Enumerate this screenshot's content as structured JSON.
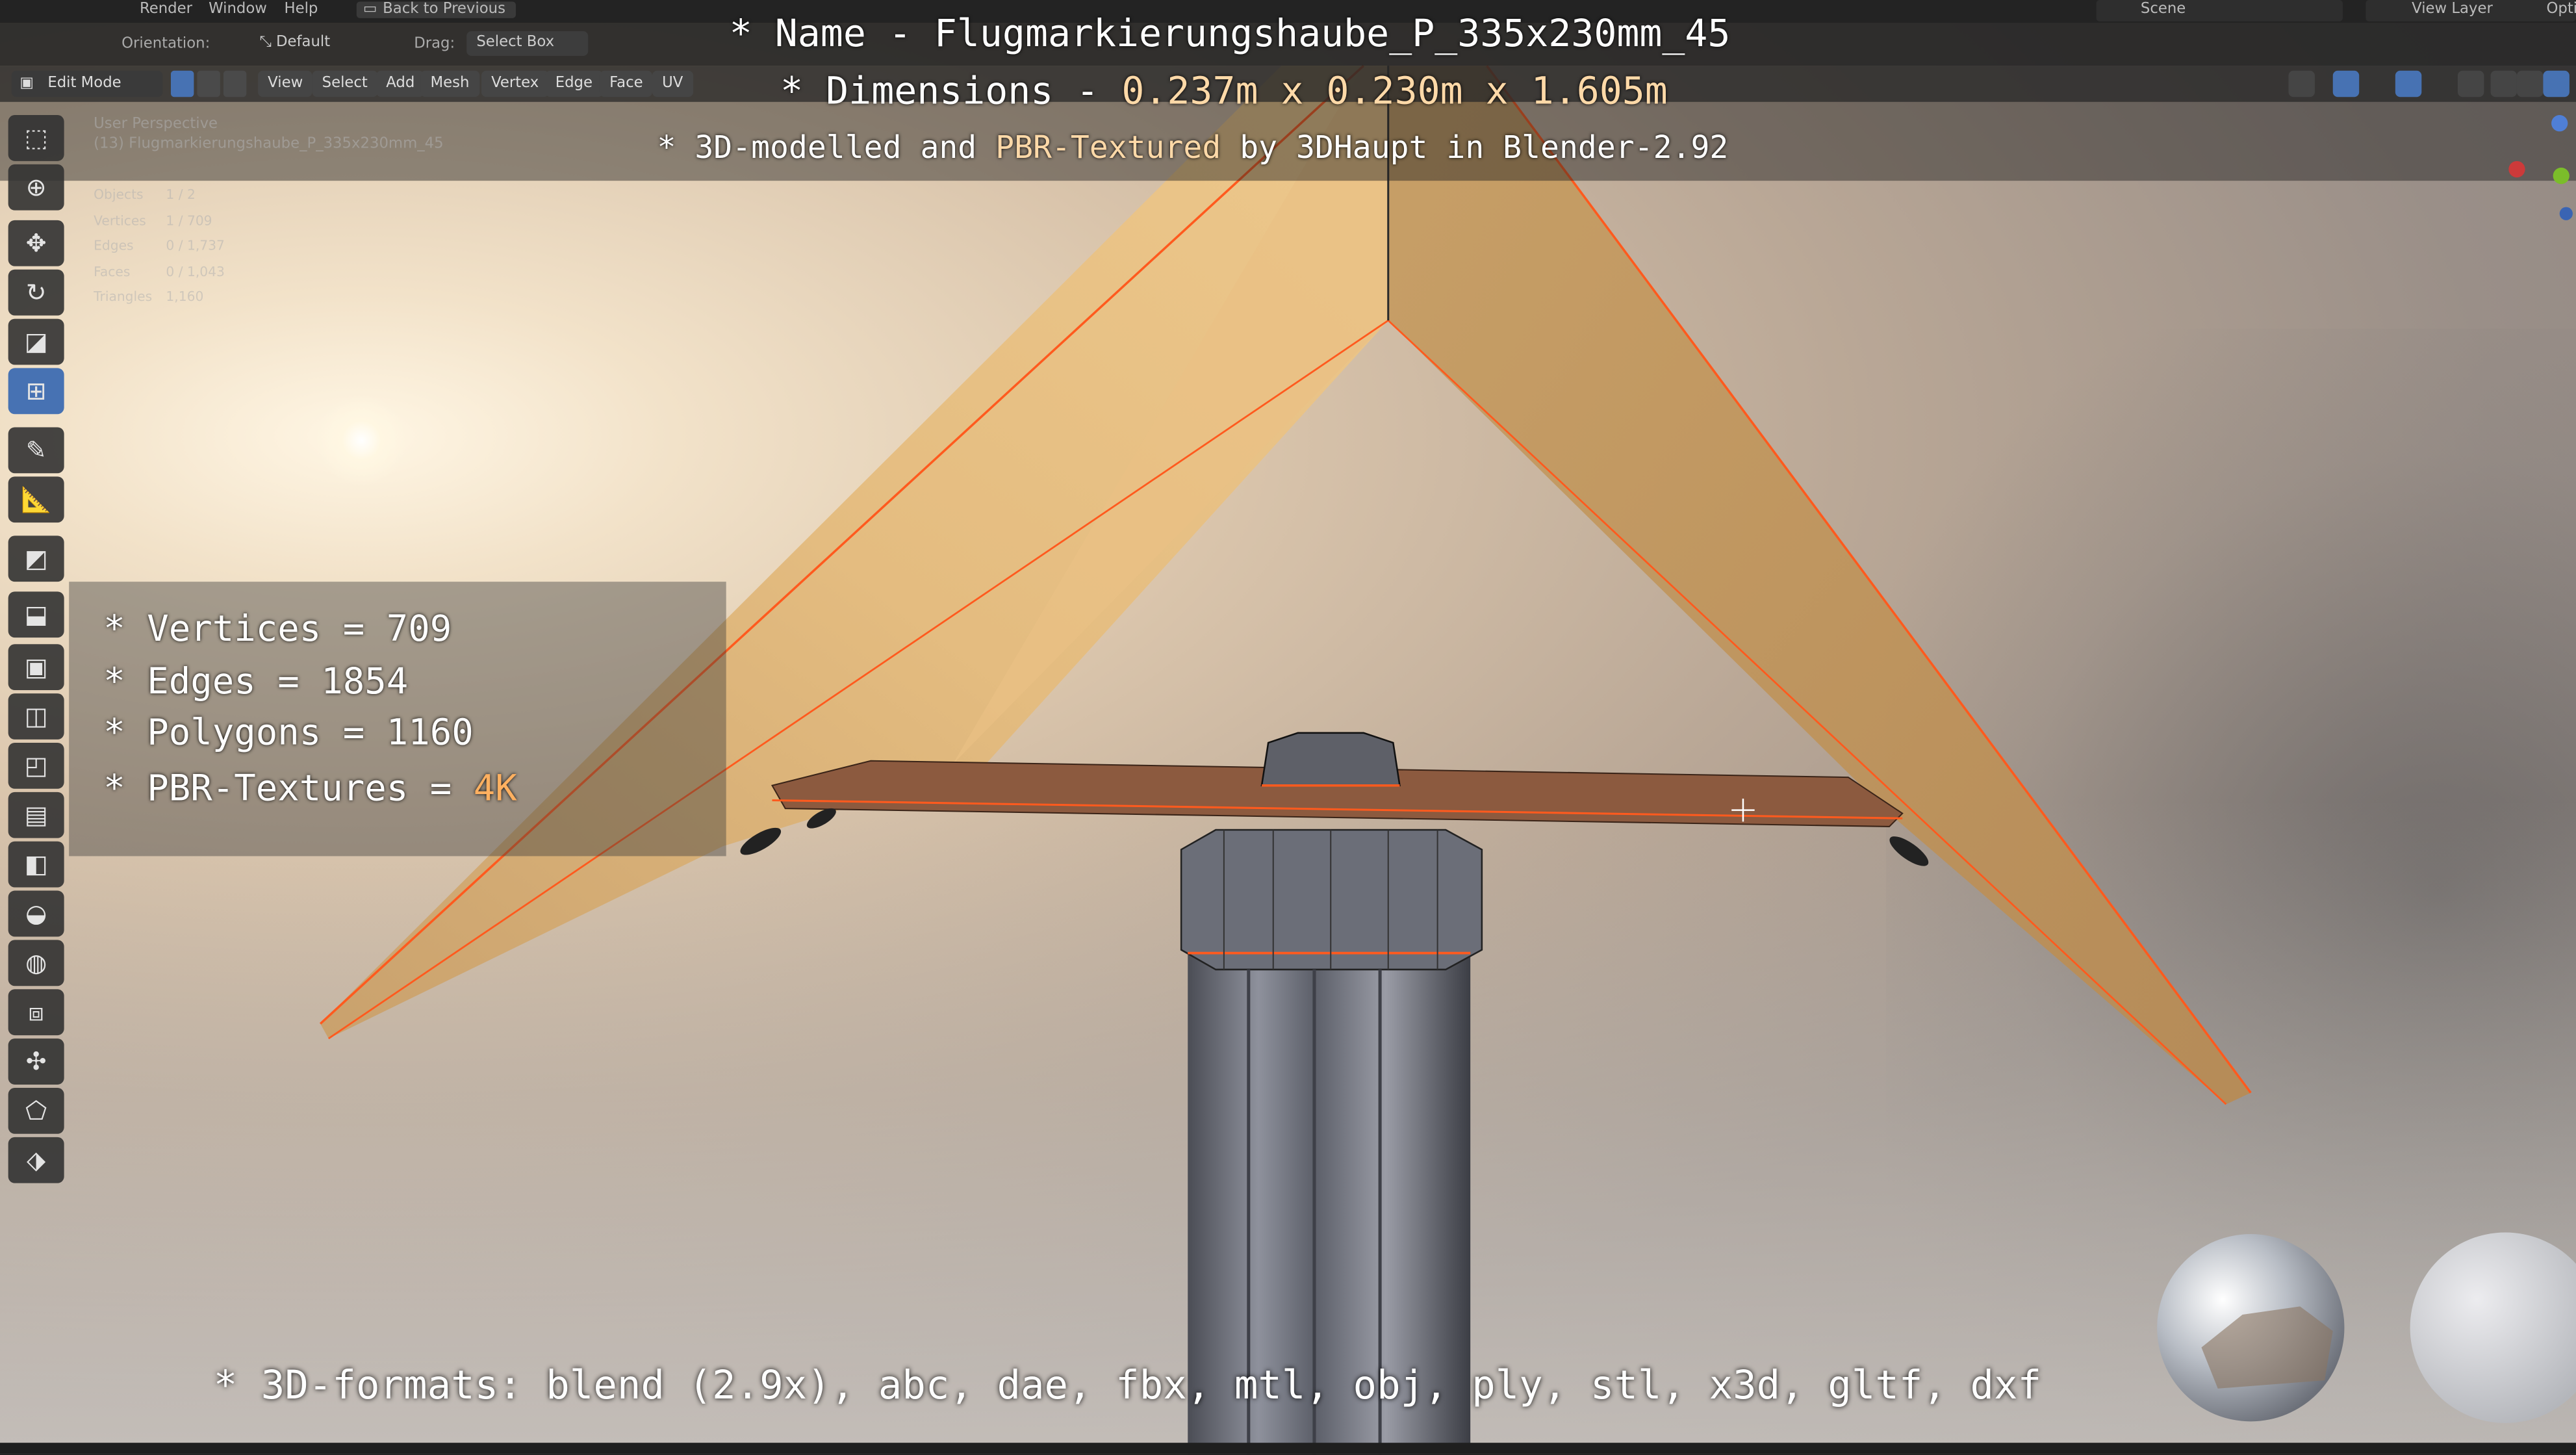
{
  "topbar": {
    "menus": [
      "Render",
      "Window",
      "Help"
    ],
    "back_label": "Back to Previous",
    "scene_label": "Scene",
    "view_layer_label": "View Layer",
    "options_label": "Opti"
  },
  "header": {
    "orientation_label": "Orientation:",
    "orientation_value": "Default",
    "drag_label": "Drag:",
    "drag_value": "Select Box"
  },
  "editor": {
    "mode": "Edit Mode",
    "menus": [
      "View",
      "Select",
      "Add",
      "Mesh",
      "Vertex",
      "Edge",
      "Face",
      "UV"
    ]
  },
  "viewport_info": {
    "view_name": "User Perspective",
    "object_name": "(13) Flugmarkierungshaube_P_335x230mm_45",
    "stats": [
      {
        "label": "Objects",
        "value": "1 / 2"
      },
      {
        "label": "Vertices",
        "value": "1 / 709"
      },
      {
        "label": "Edges",
        "value": "0 / 1,737"
      },
      {
        "label": "Faces",
        "value": "0 / 1,043"
      },
      {
        "label": "Triangles",
        "value": "1,160"
      }
    ]
  },
  "title": {
    "name_line": "* Name - Flugmarkierungshaube_P_335x230mm_45",
    "dim_prefix": "* Dimensions - ",
    "dim_value": "0.237m x 0.230m x 1.605m",
    "credit_prefix": "* 3D-modelled and ",
    "credit_highlight": "PBR-Textured",
    "credit_suffix": " by 3DHaupt in Blender-2.92"
  },
  "specs": {
    "vertices": "* Vertices = 709",
    "edges": "* Edges = 1854",
    "polygons": "* Polygons = 1160",
    "textures_prefix": "* PBR-Textures = ",
    "textures_value": "4K"
  },
  "formats": "* 3D-formats: blend (2.9x), abc, dae, fbx, mtl, obj, ply, stl, x3d, gltf, dxf",
  "tools": [
    "select-box",
    "cursor",
    "move",
    "rotate",
    "scale",
    "transform",
    "annotate",
    "measure",
    "add-cube",
    "extrude",
    "inset",
    "bevel",
    "loop-cut",
    "knife",
    "poly-build",
    "spin",
    "smooth",
    "edge-slide",
    "shrink-fatten",
    "shear",
    "rip-region"
  ],
  "colors": {
    "accent_blue": "#4772b3",
    "roof_panel": "#e6b877",
    "edge_selected": "#ff5a1e",
    "highlight_text": "#ffb060"
  }
}
